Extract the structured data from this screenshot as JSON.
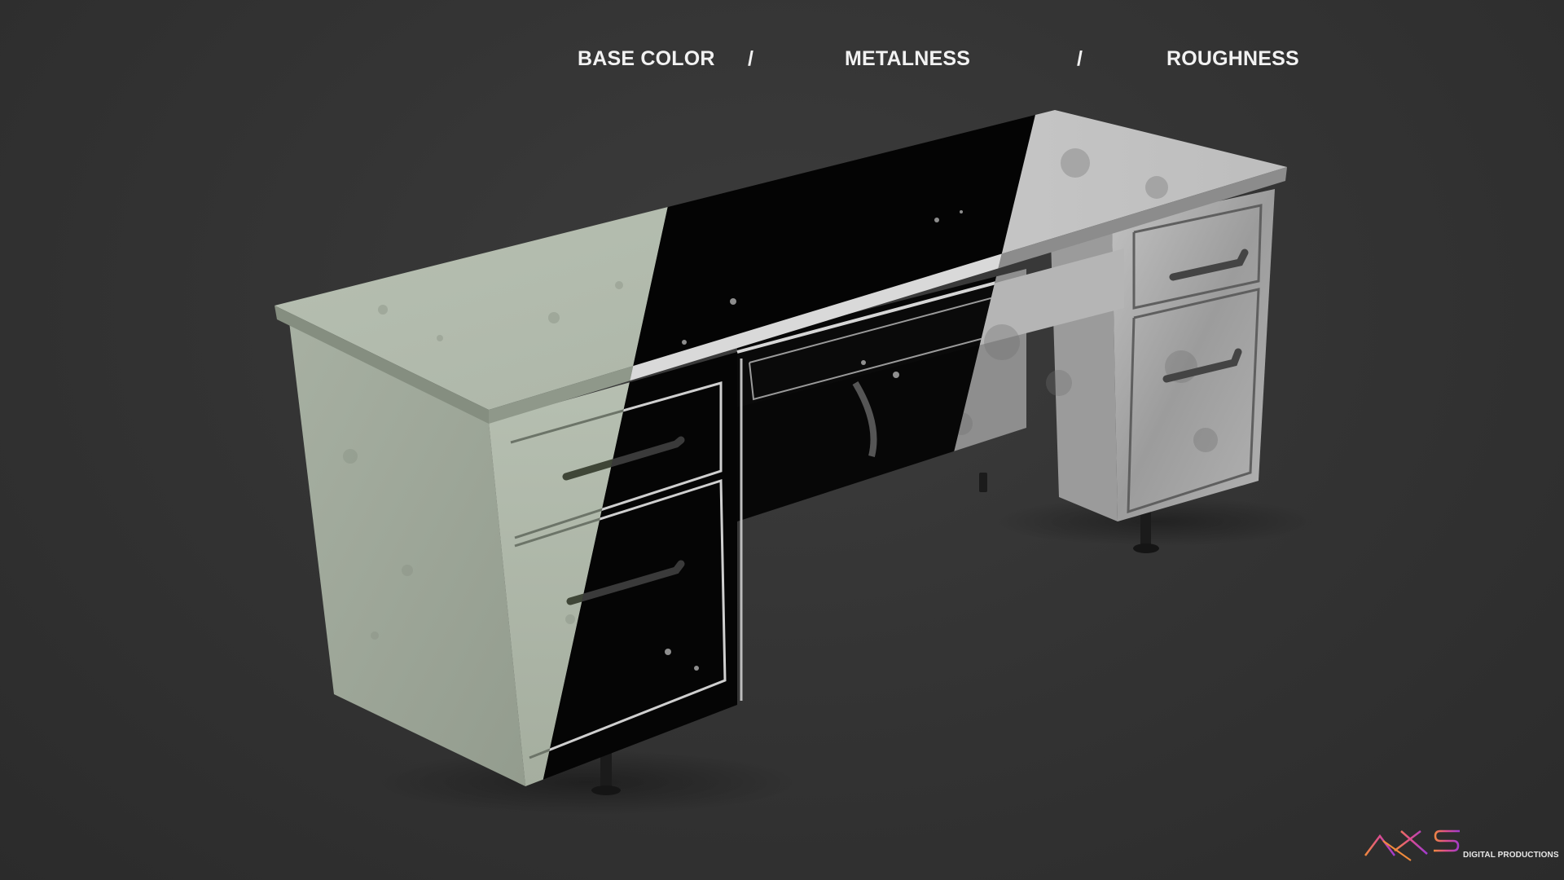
{
  "labels": {
    "base_color": "BASE COLOR",
    "separator": "/",
    "metalness": "METALNESS",
    "roughness": "ROUGHNESS"
  },
  "logo": {
    "text": "DIGITAL PRODUCTIONS",
    "name": "axis-logo"
  },
  "colors": {
    "background": "#2e2e2e",
    "base_color_surface": "#b4bdb0",
    "metalness_surface": "#050505",
    "roughness_surface": "#a8a8a8",
    "logo_orange": "#f08a3c",
    "logo_purple": "#a03ad0"
  }
}
